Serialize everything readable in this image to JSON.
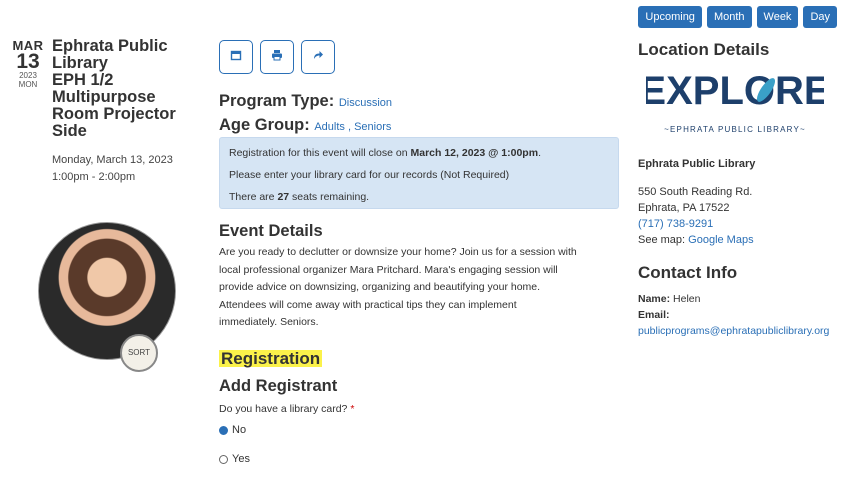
{
  "view_buttons": [
    "Upcoming",
    "Month",
    "Week",
    "Day"
  ],
  "date": {
    "month": "MAR",
    "day": "13",
    "year": "2023",
    "weekday": "MON"
  },
  "event": {
    "title_lines": [
      "Ephrata Public",
      "Library",
      "EPH 1/2",
      "Multipurpose",
      "Room Projector",
      "Side"
    ],
    "date_text": "Monday, March 13, 2023",
    "time_text": "1:00pm - 2:00pm"
  },
  "badge_text": "SORT",
  "program": {
    "type_label": "Program Type:",
    "type_value": "Discussion",
    "age_label": "Age Group:",
    "age_values": [
      "Adults",
      "Seniors"
    ]
  },
  "notice": {
    "line1_pre": "Registration for this event will close on ",
    "line1_bold": "March 12, 2023 @ 1:00pm",
    "line1_post": ".",
    "line2": "Please enter your library card for our records (Not Required)",
    "line3_pre": "There are ",
    "line3_bold": "27",
    "line3_post": " seats remaining."
  },
  "event_details": {
    "heading": "Event Details",
    "lines": [
      "Are you ready to declutter or downsize your home? Join us for a session with",
      "local professional organizer Mara Pritchard. Mara's engaging session will",
      "provide advice on downsizing, organizing and beautifying your home.",
      "Attendees will come away with practical tips they can implement",
      "immediately. Seniors."
    ]
  },
  "registration": {
    "heading": "Registration",
    "subheading": "Add Registrant",
    "question": "Do you have a library card?",
    "required_mark": "*",
    "options": [
      {
        "label": "No",
        "selected": true
      },
      {
        "label": "Yes",
        "selected": false
      }
    ]
  },
  "location": {
    "heading": "Location Details",
    "logo_word": "EXPLORE",
    "logo_sub": "~EPHRATA PUBLIC LIBRARY~",
    "library_name": "Ephrata Public Library",
    "address1": "550 South Reading Rd.",
    "address2": "Ephrata, PA 17522",
    "phone": "(717) 738-9291",
    "map_label": "See map:",
    "map_link": "Google Maps"
  },
  "contact": {
    "heading": "Contact Info",
    "name_label": "Name:",
    "name_value": "Helen",
    "email_label": "Email:",
    "email_value": "publicprograms@ephratapubliclibrary.org"
  },
  "colors": {
    "accent": "#2a6fb6",
    "notice_bg": "#d6e5f4",
    "highlight": "#fbf24a",
    "logo": "#1d3f6b",
    "logo_leaf": "#3aa0c8"
  },
  "icons": [
    "calendar-icon",
    "print-icon",
    "share-icon"
  ]
}
